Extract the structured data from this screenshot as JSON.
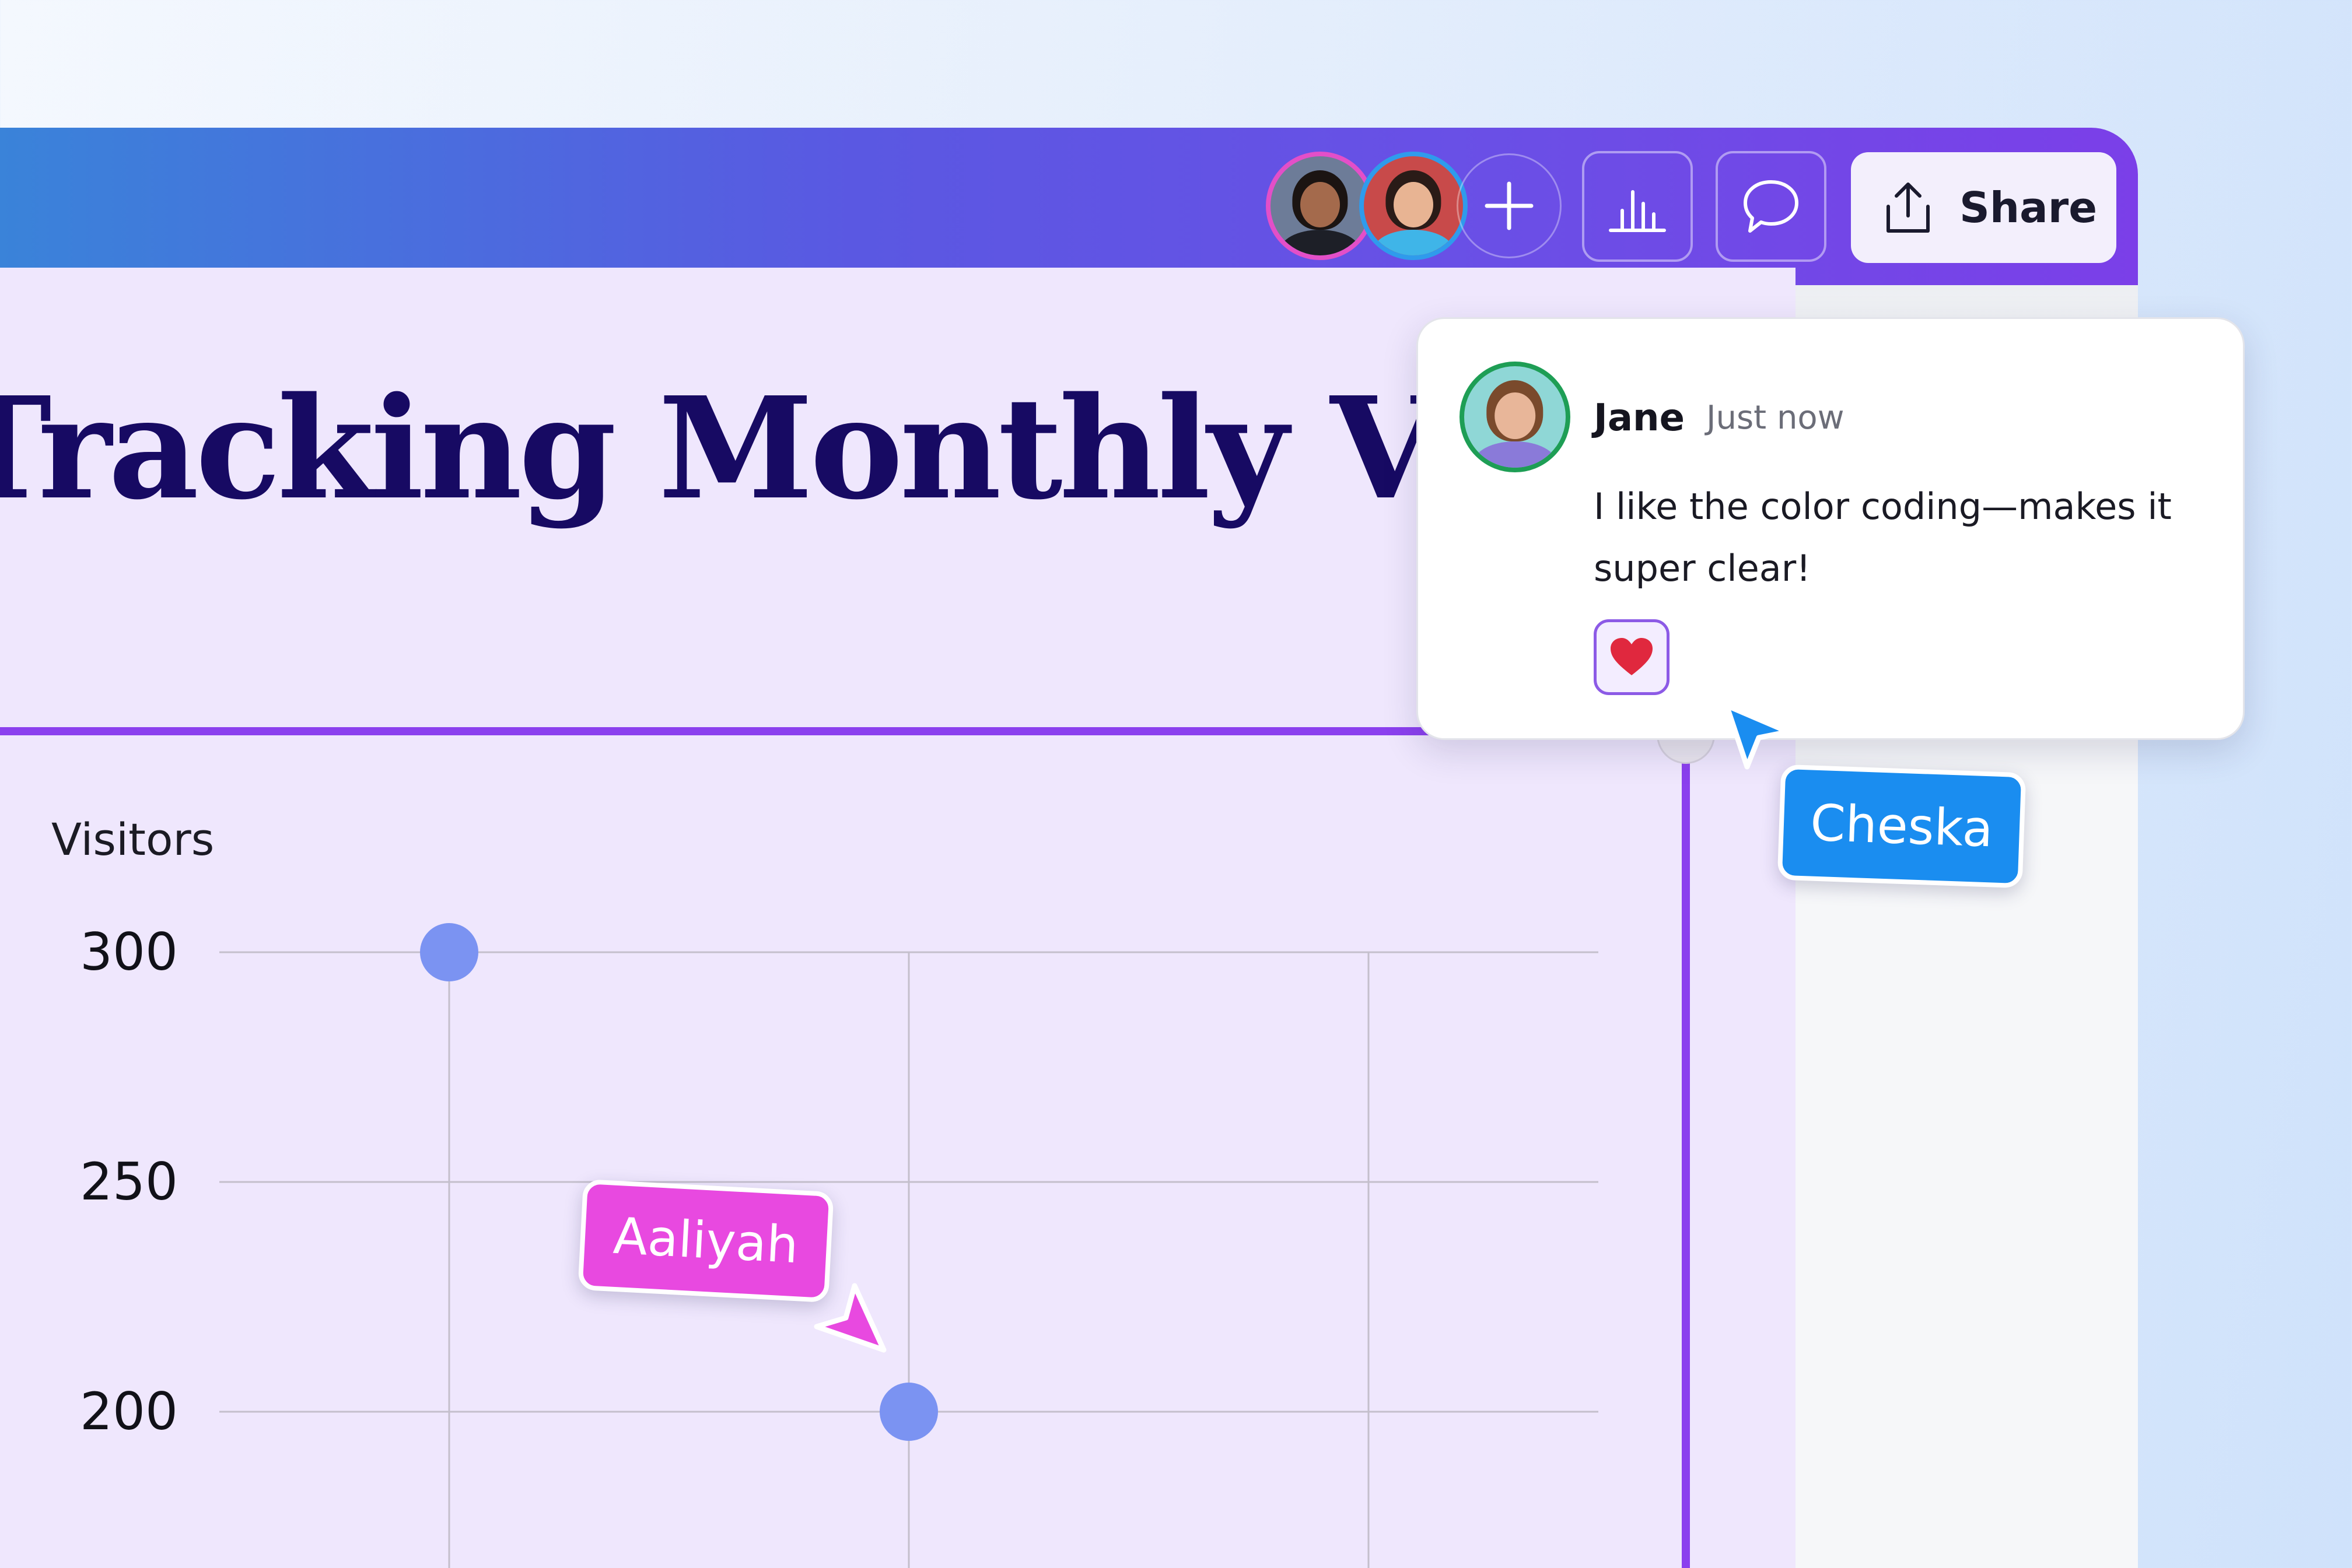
{
  "toolbar": {
    "collaborators": [
      {
        "name": "collaborator-1"
      },
      {
        "name": "collaborator-2"
      }
    ],
    "add_icon": "plus-icon",
    "insights_icon": "bar-chart-icon",
    "comment_icon": "speech-bubble-icon",
    "share_label": "Share",
    "share_icon": "upload-icon"
  },
  "design": {
    "title": "Tracking Monthly Visitors"
  },
  "comment": {
    "author": "Jane",
    "time": "Just now",
    "text": "I like the color coding—makes it super clear!",
    "reaction_icon": "heart-icon"
  },
  "cursors": {
    "cheska": "Cheska",
    "aaliyah": "Aaliyah"
  },
  "chart_data": {
    "type": "scatter",
    "ylabel": "Visitors",
    "yticks": [
      300,
      250,
      200
    ],
    "points": [
      {
        "x": 1,
        "y": 300
      },
      {
        "x": 2,
        "y": 200
      }
    ],
    "grid": true,
    "colors": {
      "point": "#7b93f2",
      "grid": "#c4bfcc"
    }
  }
}
